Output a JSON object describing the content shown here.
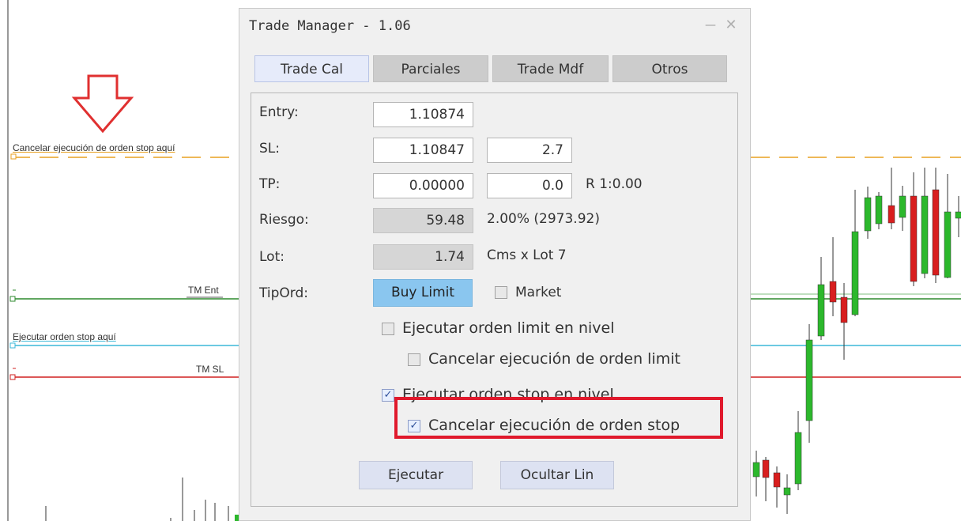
{
  "chart": {
    "labels": {
      "cancel_stop": "Cancelar ejecución de orden stop aquí",
      "tm_entry": "TM Ent",
      "execute_stop": "Ejecutar orden stop aquí",
      "tm_sl": "TM SL"
    },
    "colors": {
      "cancel_line": "#e8a020",
      "entry_line": "#2d8a2d",
      "execute_line": "#3cb8d8",
      "sl_line": "#d02020",
      "arrow": "#e03030",
      "bull_candle": "#2cb82c",
      "bear_candle": "#d81e1e"
    }
  },
  "dialog": {
    "title": "Trade Manager - 1.06",
    "minimize_label": "—",
    "close_label": "✕",
    "tabs": [
      {
        "label": "Trade Cal",
        "active": true
      },
      {
        "label": "Parciales",
        "active": false
      },
      {
        "label": "Trade Mdf",
        "active": false
      },
      {
        "label": "Otros",
        "active": false
      }
    ],
    "entry": {
      "label": "Entry:",
      "value": "1.10874"
    },
    "sl": {
      "label": "SL:",
      "price": "1.10847",
      "pips": "2.7"
    },
    "tp": {
      "label": "TP:",
      "price": "0.00000",
      "pips": "0.0",
      "ratio": "R 1:0.00"
    },
    "risk": {
      "label": "Riesgo:",
      "value": "59.48",
      "info": "2.00% (2973.92)"
    },
    "lot": {
      "label": "Lot:",
      "value": "1.74",
      "info": "Cms x Lot 7"
    },
    "order_type": {
      "label": "TipOrd:",
      "value": "Buy Limit",
      "market_label": "Market",
      "market_checked": false
    },
    "checkboxes": {
      "exec_limit": {
        "label": "Ejecutar orden limit en nivel",
        "checked": false
      },
      "cancel_limit": {
        "label": "Cancelar ejecución de orden limit",
        "checked": false
      },
      "exec_stop": {
        "label": "Ejecutar orden stop en nivel",
        "checked": true
      },
      "cancel_stop": {
        "label": "Cancelar ejecución de orden stop",
        "checked": true
      }
    },
    "check_glyph": "✓",
    "highlight_color": "#e0192c",
    "buttons": {
      "execute": "Ejecutar",
      "hide_lines": "Ocultar Lin"
    }
  }
}
